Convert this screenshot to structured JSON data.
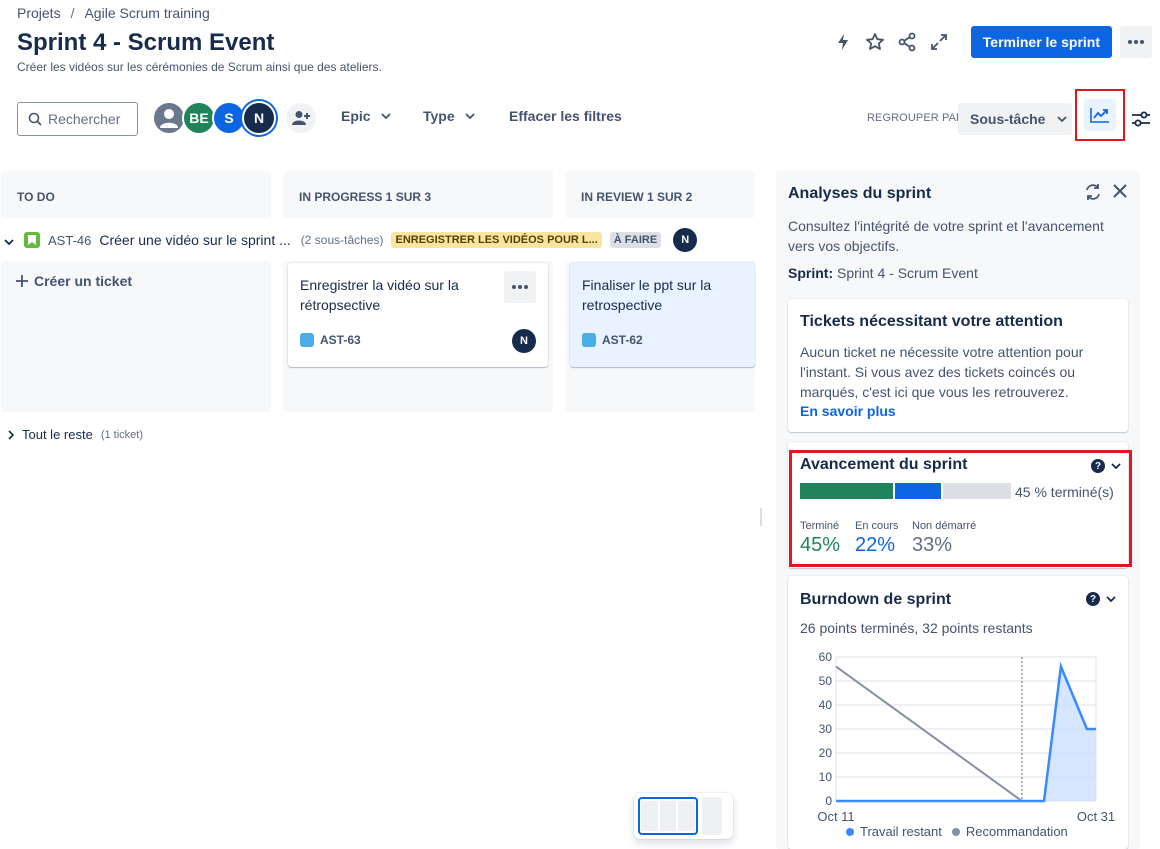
{
  "breadcrumb": {
    "root": "Projets",
    "separator": "/",
    "project": "Agile Scrum training"
  },
  "header": {
    "title": "Sprint 4 - Scrum Event",
    "subtitle": "Créer les vidéos sur les cérémonies de Scrum ainsi que des ateliers.",
    "complete_sprint_label": "Terminer le sprint",
    "primary_color": "#0c66e4"
  },
  "toolbar": {
    "search_placeholder": "Rechercher",
    "avatars": [
      {
        "initials": "",
        "color": "#6b778c"
      },
      {
        "initials": "BE",
        "color": "#1f845a"
      },
      {
        "initials": "S",
        "color": "#0c66e4"
      },
      {
        "initials": "N",
        "color": "#172b4d"
      }
    ],
    "epic_filter": "Epic",
    "type_filter": "Type",
    "clear_filters": "Effacer les filtres",
    "group_by_label": "REGROUPER PAR",
    "group_by_value": "Sous-tâche"
  },
  "columns": [
    {
      "title": "TO DO"
    },
    {
      "title": "IN PROGRESS 1 SUR 3"
    },
    {
      "title": "IN REVIEW 1 SUR 2"
    }
  ],
  "swimlane": {
    "key": "AST-46",
    "summary": "Créer une vidéo sur le sprint ...",
    "subtask_count": "(2 sous-tâches)",
    "epic_lozenge": "ENREGISTRER LES VIDÉOS POUR L...",
    "status_lozenge": "À FAIRE",
    "assignee": "N"
  },
  "board": {
    "create_ticket": "Créer un ticket",
    "cards": [
      {
        "title": "Enregistrer la vidéo sur la rétropsective",
        "key": "AST-63",
        "assignee": "N"
      },
      {
        "title": "Finaliser le ppt sur la retrospective",
        "key": "AST-62"
      }
    ],
    "rest_label": "Tout le reste",
    "rest_count": "(1 ticket)"
  },
  "panel": {
    "title": "Analyses du sprint",
    "description": "Consultez l'intégrité de votre sprint et l'avancement vers vos objectifs.",
    "sprint_label": "Sprint:",
    "sprint_value": "Sprint 4 - Scrum Event",
    "attention": {
      "title": "Tickets nécessitant votre attention",
      "text": "Aucun ticket ne nécessite votre attention pour l'instant. Si vous avez des tickets coincés ou marqués, c'est ici que vous les retrouverez.",
      "link": "En savoir plus"
    },
    "progress": {
      "title": "Avancement du sprint",
      "summary": "45 % terminé(s)",
      "done_label": "Terminé",
      "done_value": "45%",
      "done_fraction": 0.45,
      "done_color": "#1f845a",
      "inprogress_label": "En cours",
      "inprogress_value": "22%",
      "inprogress_fraction": 0.22,
      "inprogress_color": "#0c66e4",
      "notstarted_label": "Non démarré",
      "notstarted_value": "33%",
      "notstarted_fraction": 0.33,
      "notstarted_color": "#626f86",
      "notstarted_bar_color": "#dcdfe4"
    },
    "burndown": {
      "title": "Burndown de sprint",
      "subtitle": "26 points terminés, 32 points restants",
      "legend_remaining": "Travail restant",
      "legend_guideline": "Recommandation",
      "remaining_color": "#388bff",
      "guideline_color": "#8590a2"
    }
  },
  "chart_data": {
    "type": "line",
    "x_labels": [
      "Oct 11",
      "Oct 31"
    ],
    "y_ticks": [
      0,
      10,
      20,
      30,
      40,
      50,
      60
    ],
    "ylim": [
      0,
      60
    ],
    "xlim_days": [
      0,
      20
    ],
    "today_marker_day": 14.3,
    "series": [
      {
        "name": "Recommandation",
        "x": [
          0,
          14.3
        ],
        "y": [
          56,
          0
        ]
      },
      {
        "name": "Travail restant",
        "x": [
          0,
          16,
          17.3,
          19.3,
          20
        ],
        "y": [
          0,
          0,
          56,
          30,
          30
        ]
      }
    ]
  }
}
